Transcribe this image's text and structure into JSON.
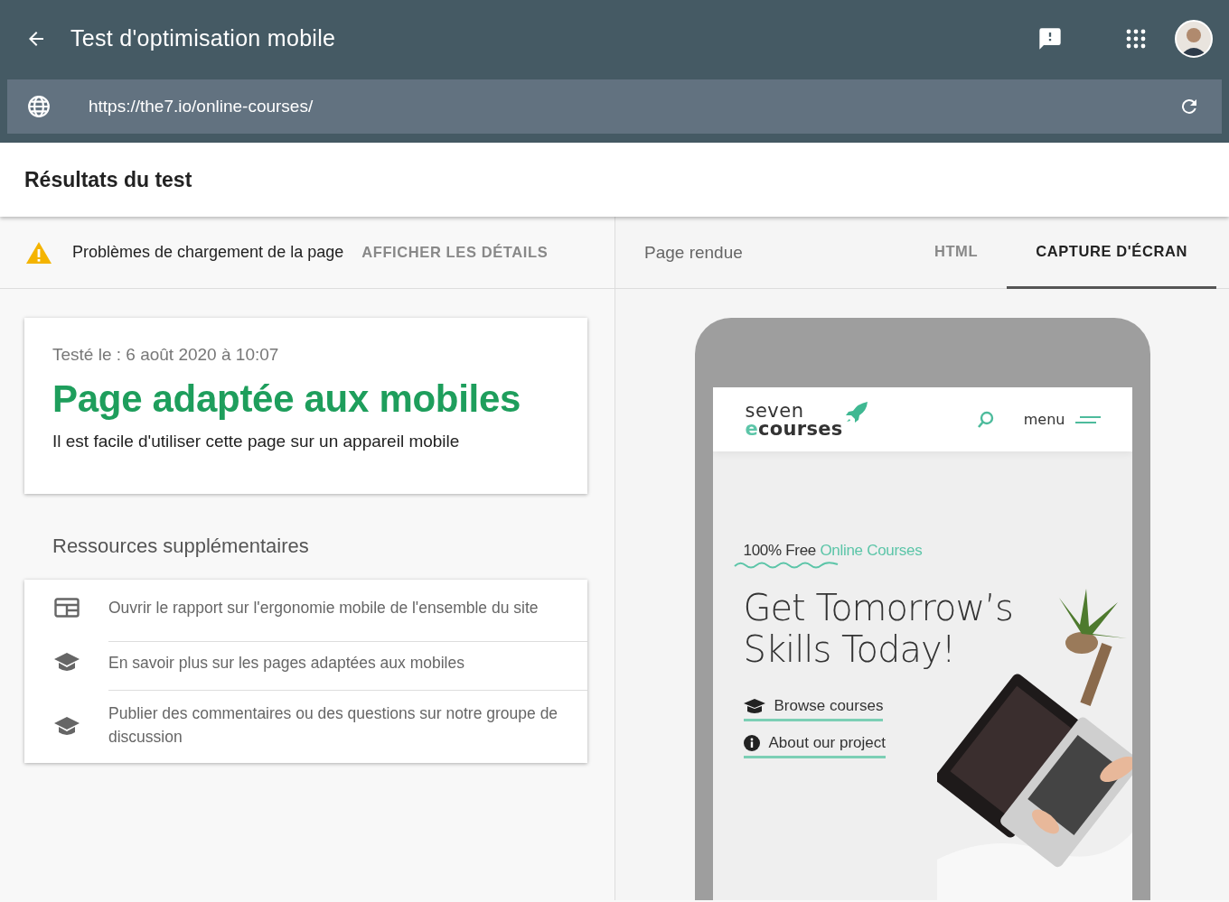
{
  "header": {
    "title": "Test d'optimisation mobile"
  },
  "url_bar": {
    "value": "https://the7.io/online-courses/"
  },
  "results": {
    "title": "Résultats du test"
  },
  "status": {
    "message": "Problèmes de chargement de la page",
    "action": "AFFICHER LES DÉTAILS"
  },
  "result_card": {
    "tested": "Testé le : 6 août 2020 à 10:07",
    "verdict": "Page adaptée aux mobiles",
    "description": "Il est facile d'utiliser cette page sur un appareil mobile"
  },
  "resources": {
    "title": "Ressources supplémentaires",
    "items": [
      {
        "kind": "report",
        "label": "Ouvrir le rapport sur l'ergonomie mobile de l'ensemble du site"
      },
      {
        "kind": "learn",
        "label": "En savoir plus sur les pages adaptées aux mobiles"
      },
      {
        "kind": "learn",
        "label": "Publier des commentaires ou des questions sur notre groupe de discussion"
      }
    ]
  },
  "preview": {
    "label": "Page rendue",
    "tabs": [
      {
        "label": "HTML",
        "selected": false
      },
      {
        "label": "CAPTURE D'ÉCRAN",
        "selected": true
      }
    ],
    "site": {
      "logo_top": "seven",
      "logo_bottom": "ecourses",
      "menu": "menu",
      "tagline": "100% Free",
      "tagline_highlight": "Online Courses",
      "heading": "Get Tomorrow’s Skills Today!",
      "links": [
        {
          "kind": "courses",
          "label": "Browse courses"
        },
        {
          "kind": "info",
          "label": "About our project"
        }
      ]
    }
  }
}
